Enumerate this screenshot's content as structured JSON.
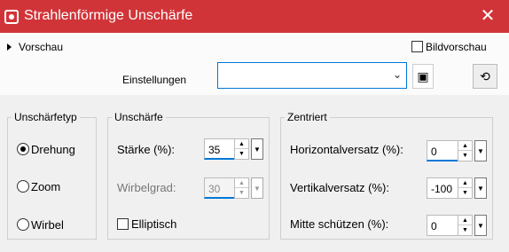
{
  "window": {
    "title": "Strahlenförmige Unschärfe",
    "close": "✕"
  },
  "top": {
    "preview_label": "Vorschau",
    "image_preview_label": "Bildvorschau",
    "settings_label": "Einstellungen",
    "settings_value": "",
    "select_arrow": "⌄"
  },
  "groups": {
    "blur_type": {
      "title": "Unschärfetyp",
      "options": [
        {
          "label": "Drehung",
          "selected": true
        },
        {
          "label": "Zoom",
          "selected": false
        },
        {
          "label": "Wirbel",
          "selected": false
        }
      ]
    },
    "blur": {
      "title": "Unschärfe",
      "strength_label": "Stärke (%):",
      "strength_value": "35",
      "twist_label": "Wirbelgrad:",
      "twist_value": "30",
      "elliptic_label": "Elliptisch"
    },
    "center": {
      "title": "Zentriert",
      "horizontal_label": "Horizontalversatz (%):",
      "horizontal_value": "0",
      "vertical_label": "Vertikalversatz (%):",
      "vertical_value": "-100",
      "protect_label": "Mitte schützen (%):",
      "protect_value": "0"
    }
  },
  "icons": {
    "spin_up": "▲",
    "spin_down": "▼",
    "dropdown": "▼",
    "save": "▣",
    "settings": "⟲"
  }
}
